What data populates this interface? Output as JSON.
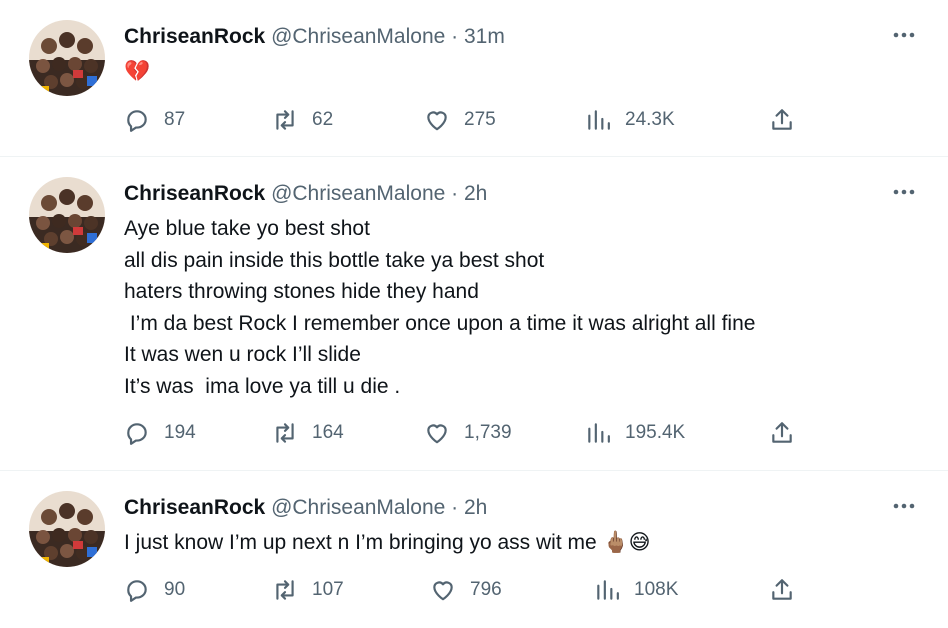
{
  "tweets": [
    {
      "display_name": "ChriseanRock",
      "handle": "@ChriseanMalone",
      "separator": "·",
      "time": "31m",
      "text": "💔",
      "stats": {
        "replies": "87",
        "retweets": "62",
        "likes": "275",
        "views": "24.3K"
      }
    },
    {
      "display_name": "ChriseanRock",
      "handle": "@ChriseanMalone",
      "separator": "·",
      "time": "2h",
      "text": "Aye blue take yo best shot\nall dis pain inside this bottle take ya best shot\nhaters throwing stones hide they hand\n I’m da best Rock I remember once upon a time it was alright all fine\nIt was wen u rock I’ll slide\nIt’s was  ima love ya till u die .",
      "stats": {
        "replies": "194",
        "retweets": "164",
        "likes": "1,739",
        "views": "195.4K"
      }
    },
    {
      "display_name": "ChriseanRock",
      "handle": "@ChriseanMalone",
      "separator": "·",
      "time": "2h",
      "text": "I just know I’m up next n I’m bringing yo ass wit me 🖕🏽😅",
      "stats": {
        "replies": "90",
        "retweets": "107",
        "likes": "796",
        "views": "108K"
      }
    }
  ],
  "icons": {
    "reply": "reply-icon",
    "retweet": "retweet-icon",
    "like": "like-icon",
    "views": "views-icon",
    "share": "share-icon",
    "more": "more-icon"
  },
  "colors": {
    "text": "#0f1419",
    "secondary": "#536471",
    "divider": "#eff3f4"
  }
}
